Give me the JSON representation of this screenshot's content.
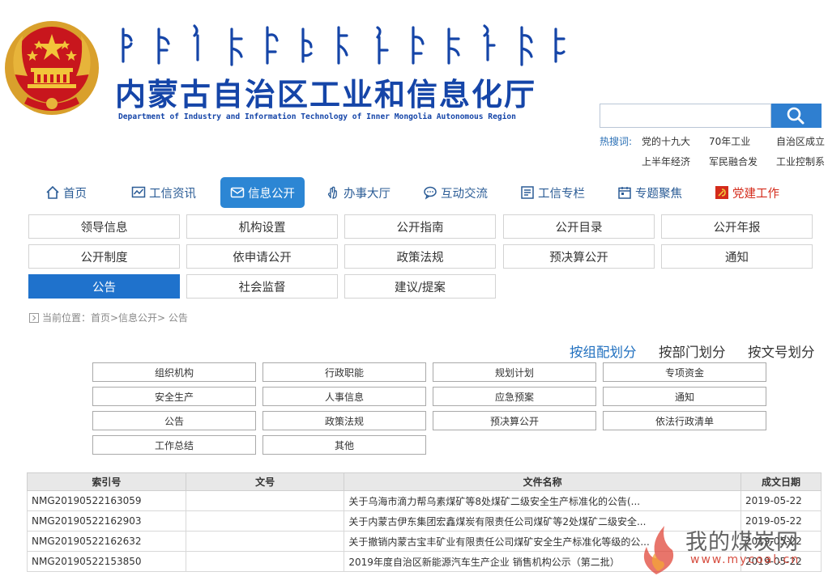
{
  "header": {
    "mongolian_script": "ᠥᠪᠥᠷ ᠮᠣᠩᠭᠣᠯ ᠤᠨ ᠠᠵᠤ ᠦᠢᠯᠡᠳᠪᠦᠷᠢ",
    "title": "内蒙古自治区工业和信息化厅",
    "subtitle": "Department of Industry and Information Technology of Inner Mongolia Autonomous Region"
  },
  "search": {
    "placeholder": "",
    "hot_label": "热搜词:",
    "hot_words": [
      "党的十九大",
      "70年工业",
      "自治区成立",
      "上半年经济",
      "军民融合发",
      "工业控制系"
    ]
  },
  "nav": {
    "items": [
      {
        "label": "首页",
        "icon": "home-icon"
      },
      {
        "label": "工信资讯",
        "icon": "chart-icon"
      },
      {
        "label": "信息公开",
        "icon": "mail-icon"
      },
      {
        "label": "办事大厅",
        "icon": "hand-icon"
      },
      {
        "label": "互动交流",
        "icon": "chat-icon"
      },
      {
        "label": "工信专栏",
        "icon": "list-icon"
      },
      {
        "label": "专题聚焦",
        "icon": "calendar-icon"
      },
      {
        "label": "党建工作",
        "icon": "party-icon"
      }
    ]
  },
  "submenu": {
    "items": [
      "领导信息",
      "机构设置",
      "公开指南",
      "公开目录",
      "公开年报",
      "公开制度",
      "依申请公开",
      "政策法规",
      "预决算公开",
      "通知",
      "公告",
      "社会监督",
      "建议/提案"
    ]
  },
  "breadcrumb": {
    "text": "当前位置：首页>信息公开> 公告"
  },
  "group_tabs": [
    "按组配划分",
    "按部门划分",
    "按文号划分"
  ],
  "categories": [
    "组织机构",
    "行政职能",
    "规划计划",
    "专项资金",
    "安全生产",
    "人事信息",
    "应急预案",
    "通知",
    "公告",
    "政策法规",
    "预决算公开",
    "依法行政清单",
    "工作总结",
    "其他"
  ],
  "table": {
    "headers": [
      "索引号",
      "文号",
      "文件名称",
      "成文日期"
    ],
    "rows": [
      {
        "index": "NMG20190522163059",
        "doc_no": "",
        "title": "关于乌海市滴力帮乌素煤矿等8处煤矿二级安全生产标准化的公告(...",
        "date": "2019-05-22"
      },
      {
        "index": "NMG20190522162903",
        "doc_no": "",
        "title": "关于内蒙古伊东集团宏鑫煤炭有限责任公司煤矿等2处煤矿二级安全...",
        "date": "2019-05-22"
      },
      {
        "index": "NMG20190522162632",
        "doc_no": "",
        "title": "关于撤销内蒙古宝丰矿业有限责任公司煤矿安全生产标准化等级的公...",
        "date": "2019-05-22"
      },
      {
        "index": "NMG20190522153850",
        "doc_no": "",
        "title": "2019年度自治区新能源汽车生产企业 销售机构公示（第二批）",
        "date": "2019-05-22"
      }
    ]
  },
  "watermark": {
    "text": "我的煤炭网",
    "url": "www.mycoal.cn"
  },
  "colors": {
    "brand_blue": "#1545a8",
    "active_blue": "#2c86d4",
    "party_red": "#d42b1b"
  }
}
